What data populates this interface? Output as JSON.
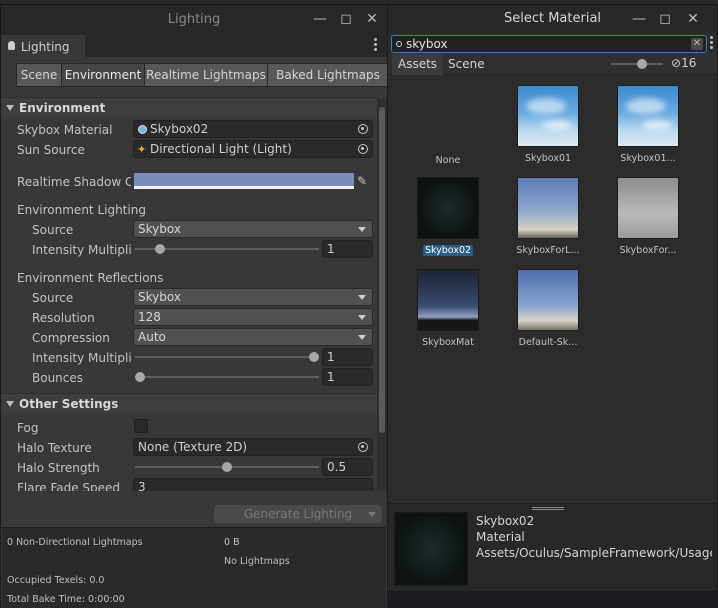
{
  "lighting": {
    "title": "Lighting",
    "tab": "Lighting",
    "tabs": [
      "Scene",
      "Environment",
      "Realtime Lightmaps",
      "Baked Lightmaps"
    ],
    "sections": {
      "environment": {
        "header": "Environment",
        "skybox_material_label": "Skybox Material",
        "skybox_material_value": "Skybox02",
        "sun_source_label": "Sun Source",
        "sun_source_value": "Directional Light (Light)",
        "shadow_color_label": "Realtime Shadow Color",
        "shadow_color": "#7b8bba",
        "env_lighting_label": "Environment Lighting",
        "source_label": "Source",
        "source_value": "Skybox",
        "intensity_label": "Intensity Multiplier",
        "intensity_value": "1",
        "env_reflections_label": "Environment Reflections",
        "refl_source_label": "Source",
        "refl_source_value": "Skybox",
        "resolution_label": "Resolution",
        "resolution_value": "128",
        "compression_label": "Compression",
        "compression_value": "Auto",
        "refl_intensity_label": "Intensity Multiplier",
        "refl_intensity_value": "1",
        "bounces_label": "Bounces",
        "bounces_value": "1"
      },
      "other": {
        "header": "Other Settings",
        "fog_label": "Fog",
        "halo_texture_label": "Halo Texture",
        "halo_texture_value": "None (Texture 2D)",
        "halo_strength_label": "Halo Strength",
        "halo_strength_value": "0.5",
        "flare_fade_label": "Flare Fade Speed",
        "flare_fade_value": "3"
      }
    },
    "generate_label": "Generate Lighting",
    "stats": {
      "lightmaps": "0 Non-Directional Lightmaps",
      "size": "0 B",
      "no_lightmaps": "No Lightmaps",
      "occupied": "Occupied Texels: 0.0",
      "bake_time": "Total Bake Time: 0:00:00"
    }
  },
  "select_material": {
    "title": "Select Material",
    "search_value": "skybox",
    "tabs": [
      "Assets",
      "Scene"
    ],
    "hidden_count": "16",
    "items": [
      {
        "name": "None"
      },
      {
        "name": "Skybox01"
      },
      {
        "name": "Skybox01..."
      },
      {
        "name": "Skybox02"
      },
      {
        "name": "SkyboxForL..."
      },
      {
        "name": "SkyboxFor..."
      },
      {
        "name": "SkyboxMat"
      },
      {
        "name": "Default-Sk..."
      }
    ],
    "preview": {
      "name": "Skybox02",
      "type": "Material",
      "path": "Assets/Oculus/SampleFramework/Usage"
    }
  }
}
